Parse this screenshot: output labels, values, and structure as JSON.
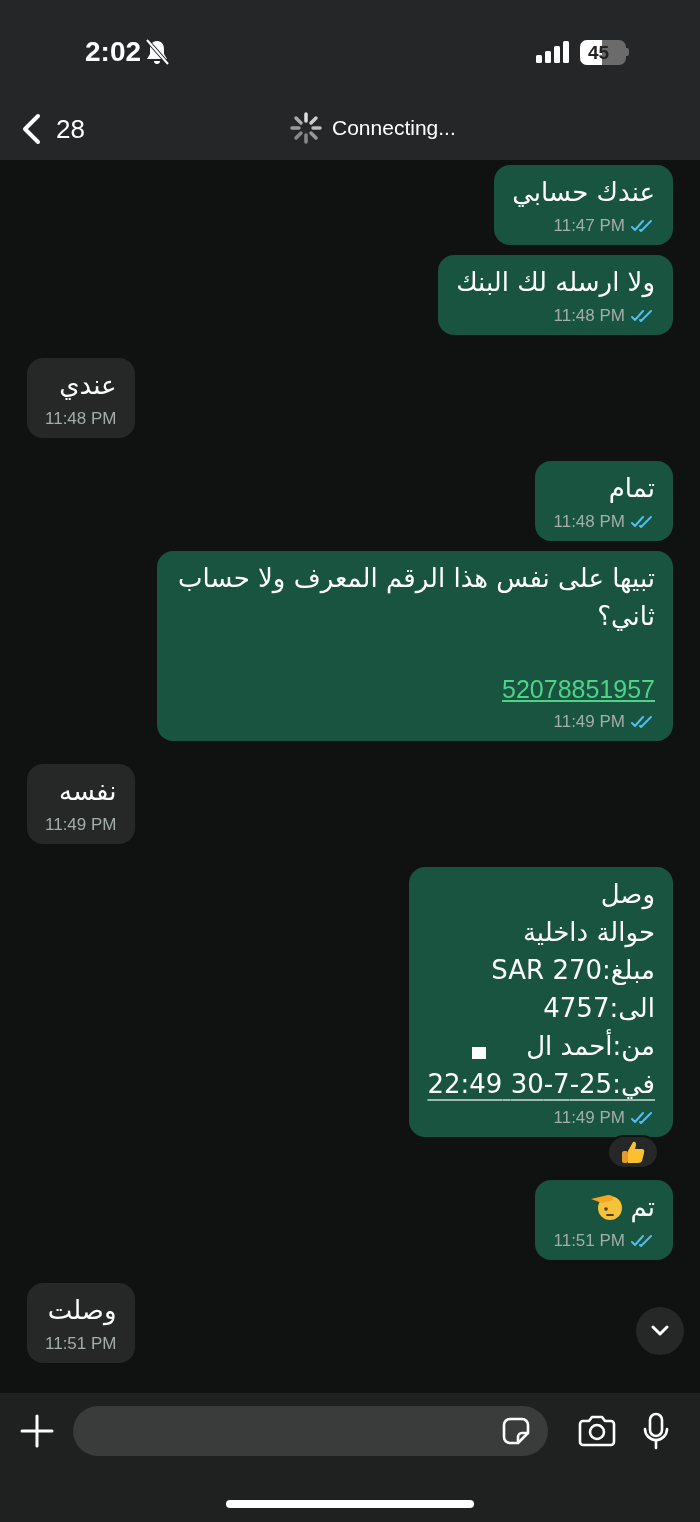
{
  "status_bar": {
    "time": "2:02",
    "silent": true,
    "battery": "45"
  },
  "header": {
    "back_count": "28",
    "status": "Connecting..."
  },
  "messages": [
    {
      "outgoing": true,
      "paragraphs": [
        {
          "kind": "text",
          "lines": [
            "عندك حسابي"
          ]
        }
      ],
      "time": "11:47 PM",
      "read": true
    },
    {
      "outgoing": true,
      "paragraphs": [
        {
          "kind": "text",
          "lines": [
            "ولا ارسله لك البنك"
          ]
        }
      ],
      "time": "11:48 PM",
      "read": true
    },
    {
      "outgoing": false,
      "paragraphs": [
        {
          "kind": "text",
          "lines": [
            "عندي"
          ]
        }
      ],
      "time": "11:48 PM"
    },
    {
      "outgoing": true,
      "paragraphs": [
        {
          "kind": "text",
          "lines": [
            "تمام"
          ]
        }
      ],
      "time": "11:48 PM",
      "read": true
    },
    {
      "outgoing": true,
      "paragraphs": [
        {
          "kind": "text",
          "lines": [
            "تبيها على نفس هذا الرقم المعرف ولا حساب ثاني؟"
          ]
        },
        {
          "kind": "link",
          "lines": [
            "52078851957"
          ]
        }
      ],
      "time": "11:49 PM",
      "read": true
    },
    {
      "outgoing": false,
      "paragraphs": [
        {
          "kind": "text",
          "lines": [
            "نفسه"
          ]
        }
      ],
      "time": "11:49 PM"
    },
    {
      "outgoing": true,
      "paragraphs": [
        {
          "kind": "text",
          "lines": [
            "وصل",
            "حوالة داخلية",
            "مبلغ:SAR 270",
            "الى:4757"
          ]
        },
        {
          "kind": "redacted",
          "lines": [
            "من:أحمد ال"
          ]
        },
        {
          "kind": "date",
          "lines": [
            "في:25-7-30 22:49"
          ]
        }
      ],
      "time": "11:49 PM",
      "read": true,
      "thumbs_up_reaction": true
    },
    {
      "outgoing": true,
      "paragraphs": [
        {
          "kind": "text",
          "lines": [
            "تم"
          ]
        }
      ],
      "salute_emoji": true,
      "time": "11:51 PM",
      "read": true
    },
    {
      "outgoing": false,
      "paragraphs": [
        {
          "kind": "text",
          "lines": [
            "وصلت"
          ]
        }
      ],
      "time": "11:51 PM"
    }
  ],
  "composer": {
    "has_text": false
  }
}
